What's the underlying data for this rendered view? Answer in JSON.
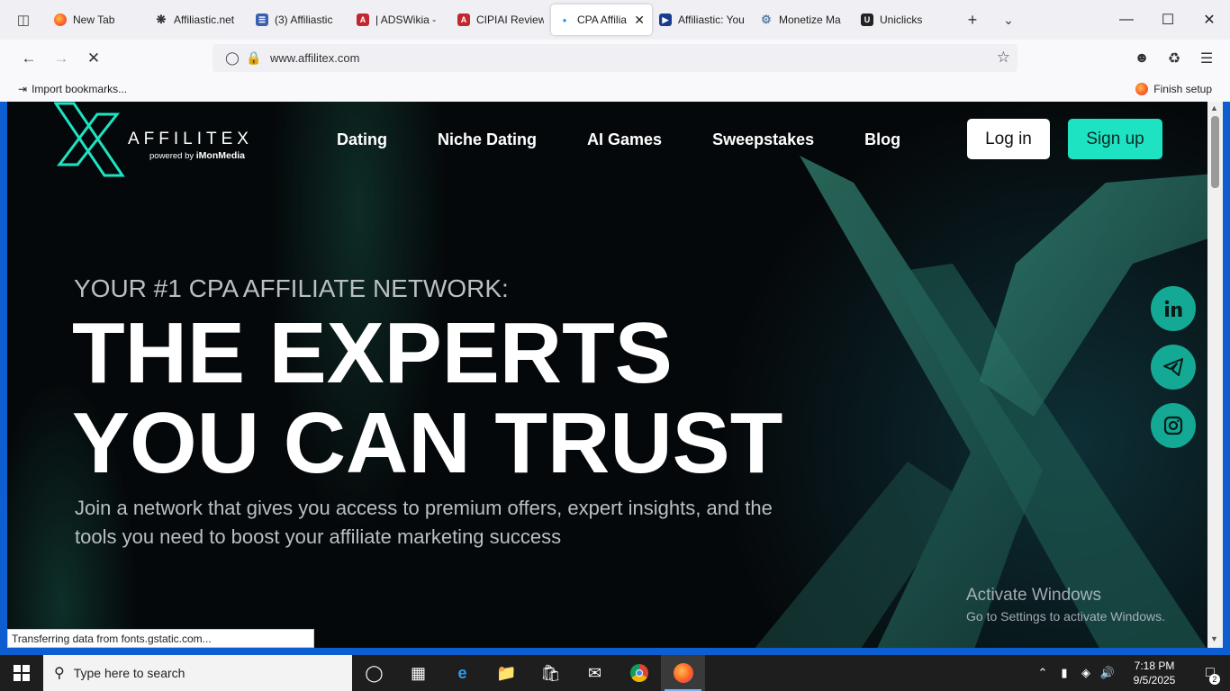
{
  "browser": {
    "tabs": [
      {
        "label": "New Tab",
        "favicon": "firefox-icon",
        "color": "#ff7139"
      },
      {
        "label": "Affiliastic.net",
        "favicon": "openai-icon",
        "color": "#333333"
      },
      {
        "label": "(3) Affiliastic",
        "favicon": "stack-icon",
        "color": "#3a5fb0"
      },
      {
        "label": "| ADSWikia -",
        "favicon": "a-logo-icon",
        "color": "#c4262e"
      },
      {
        "label": "CIPIAI Review",
        "favicon": "a-logo-icon",
        "color": "#c4262e"
      },
      {
        "label": "CPA Affilia",
        "favicon": "dot-icon",
        "color": "#1e90ff",
        "active": true
      },
      {
        "label": "Affiliastic: You",
        "favicon": "flag-icon",
        "color": "#1a3c8f"
      },
      {
        "label": "Monetize Ma",
        "favicon": "gear-icon",
        "color": "#5a7fa6"
      },
      {
        "label": "Uniclicks",
        "favicon": "u-logo-icon",
        "color": "#222222"
      }
    ],
    "url": "www.affilitex.com",
    "bookmarks": {
      "import_label": "Import bookmarks...",
      "finish_label": "Finish setup"
    },
    "status_text": "Transferring data from fonts.gstatic.com..."
  },
  "site": {
    "logo": {
      "word": "AFFILITEX",
      "powered_prefix": "powered by",
      "powered_brand": "iMonMedia"
    },
    "nav": [
      "Dating",
      "Niche Dating",
      "AI Games",
      "Sweepstakes",
      "Blog"
    ],
    "login_label": "Log in",
    "signup_label": "Sign up",
    "eyebrow": "YOUR #1 CPA AFFILIATE NETWORK:",
    "hero_line1": "THE EXPERTS",
    "hero_line2": "YOU CAN TRUST",
    "subtitle": "Join a network that gives you access to premium offers, expert insights, and the tools you need to boost your affiliate marketing success",
    "accent_color": "#1ee3c2",
    "social": [
      "linkedin-icon",
      "telegram-icon",
      "instagram-icon"
    ]
  },
  "watermark": {
    "line1": "Activate Windows",
    "line2": "Go to Settings to activate Windows."
  },
  "taskbar": {
    "search_placeholder": "Type here to search",
    "time": "7:18 PM",
    "date": "9/5/2025",
    "notifications": "2"
  }
}
